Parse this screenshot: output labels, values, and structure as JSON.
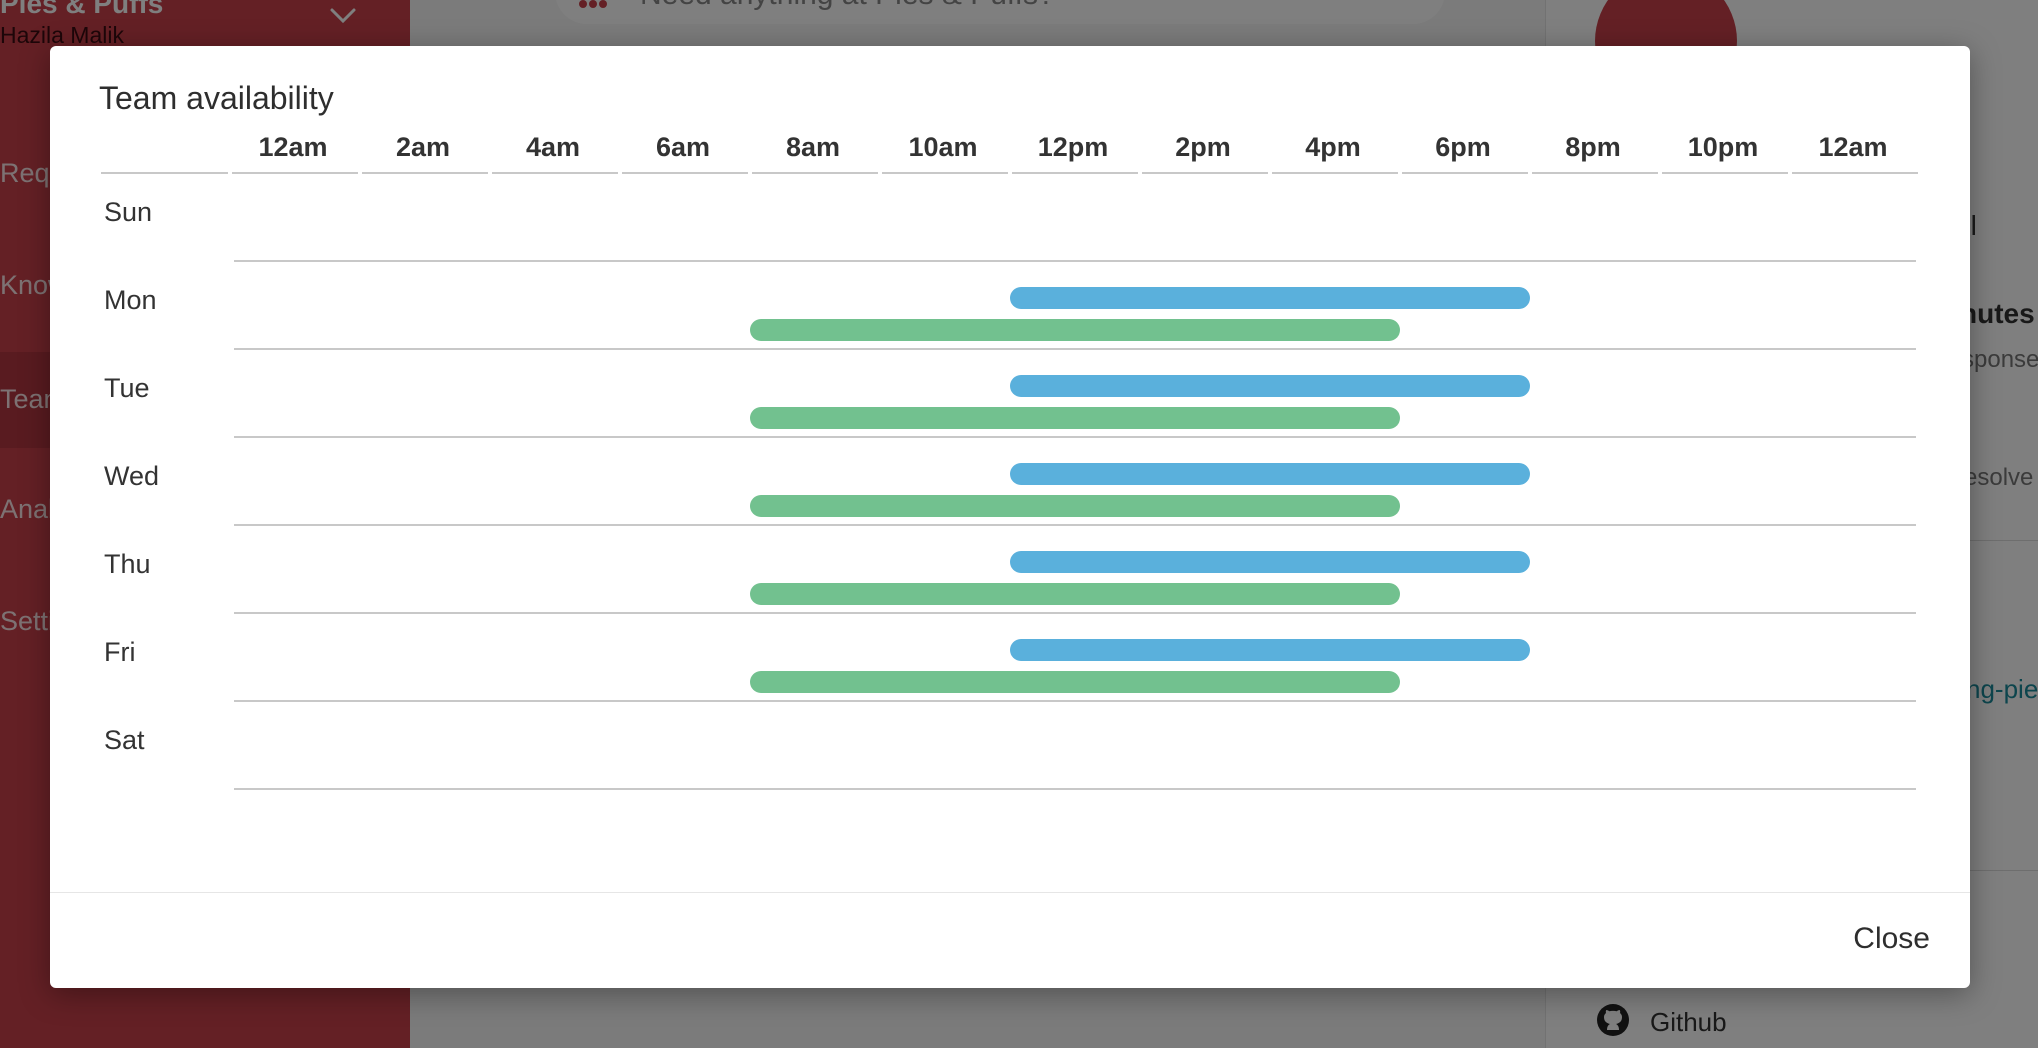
{
  "background": {
    "sidebar": {
      "org_name": "Pies & Puffs",
      "user_name": "Hazila Malik",
      "items": [
        "Requests",
        "Knowledge",
        "Teams",
        "Analytics",
        "Settings"
      ],
      "active_index": 2
    },
    "search": {
      "placeholder": "Need anything at Pies & Puffs?"
    },
    "right_pane": {
      "texts": [
        "ul",
        "nutes",
        "sponse",
        "esolve",
        "ng-pie"
      ],
      "footer_link": "Github"
    },
    "colors": {
      "brand": "#c8414a"
    }
  },
  "modal": {
    "title": "Team availability",
    "close_label": "Close"
  },
  "chart_data": {
    "type": "timeline",
    "time_ticks": [
      "12am",
      "2am",
      "4am",
      "6am",
      "8am",
      "10am",
      "12pm",
      "2pm",
      "4pm",
      "6pm",
      "8pm",
      "10pm",
      "12am"
    ],
    "x_range_hours": [
      0,
      26
    ],
    "days": [
      "Sun",
      "Mon",
      "Tue",
      "Wed",
      "Thu",
      "Fri",
      "Sat"
    ],
    "series": [
      {
        "color": "#5ab0dc",
        "ranges": [
          {
            "day": "Mon",
            "start": 12,
            "end": 20
          },
          {
            "day": "Tue",
            "start": 12,
            "end": 20
          },
          {
            "day": "Wed",
            "start": 12,
            "end": 20
          },
          {
            "day": "Thu",
            "start": 12,
            "end": 20
          },
          {
            "day": "Fri",
            "start": 12,
            "end": 20
          }
        ]
      },
      {
        "color": "#72c18f",
        "ranges": [
          {
            "day": "Mon",
            "start": 8,
            "end": 18
          },
          {
            "day": "Tue",
            "start": 8,
            "end": 18
          },
          {
            "day": "Wed",
            "start": 8,
            "end": 18
          },
          {
            "day": "Thu",
            "start": 8,
            "end": 18
          },
          {
            "day": "Fri",
            "start": 8,
            "end": 18
          }
        ]
      }
    ]
  }
}
